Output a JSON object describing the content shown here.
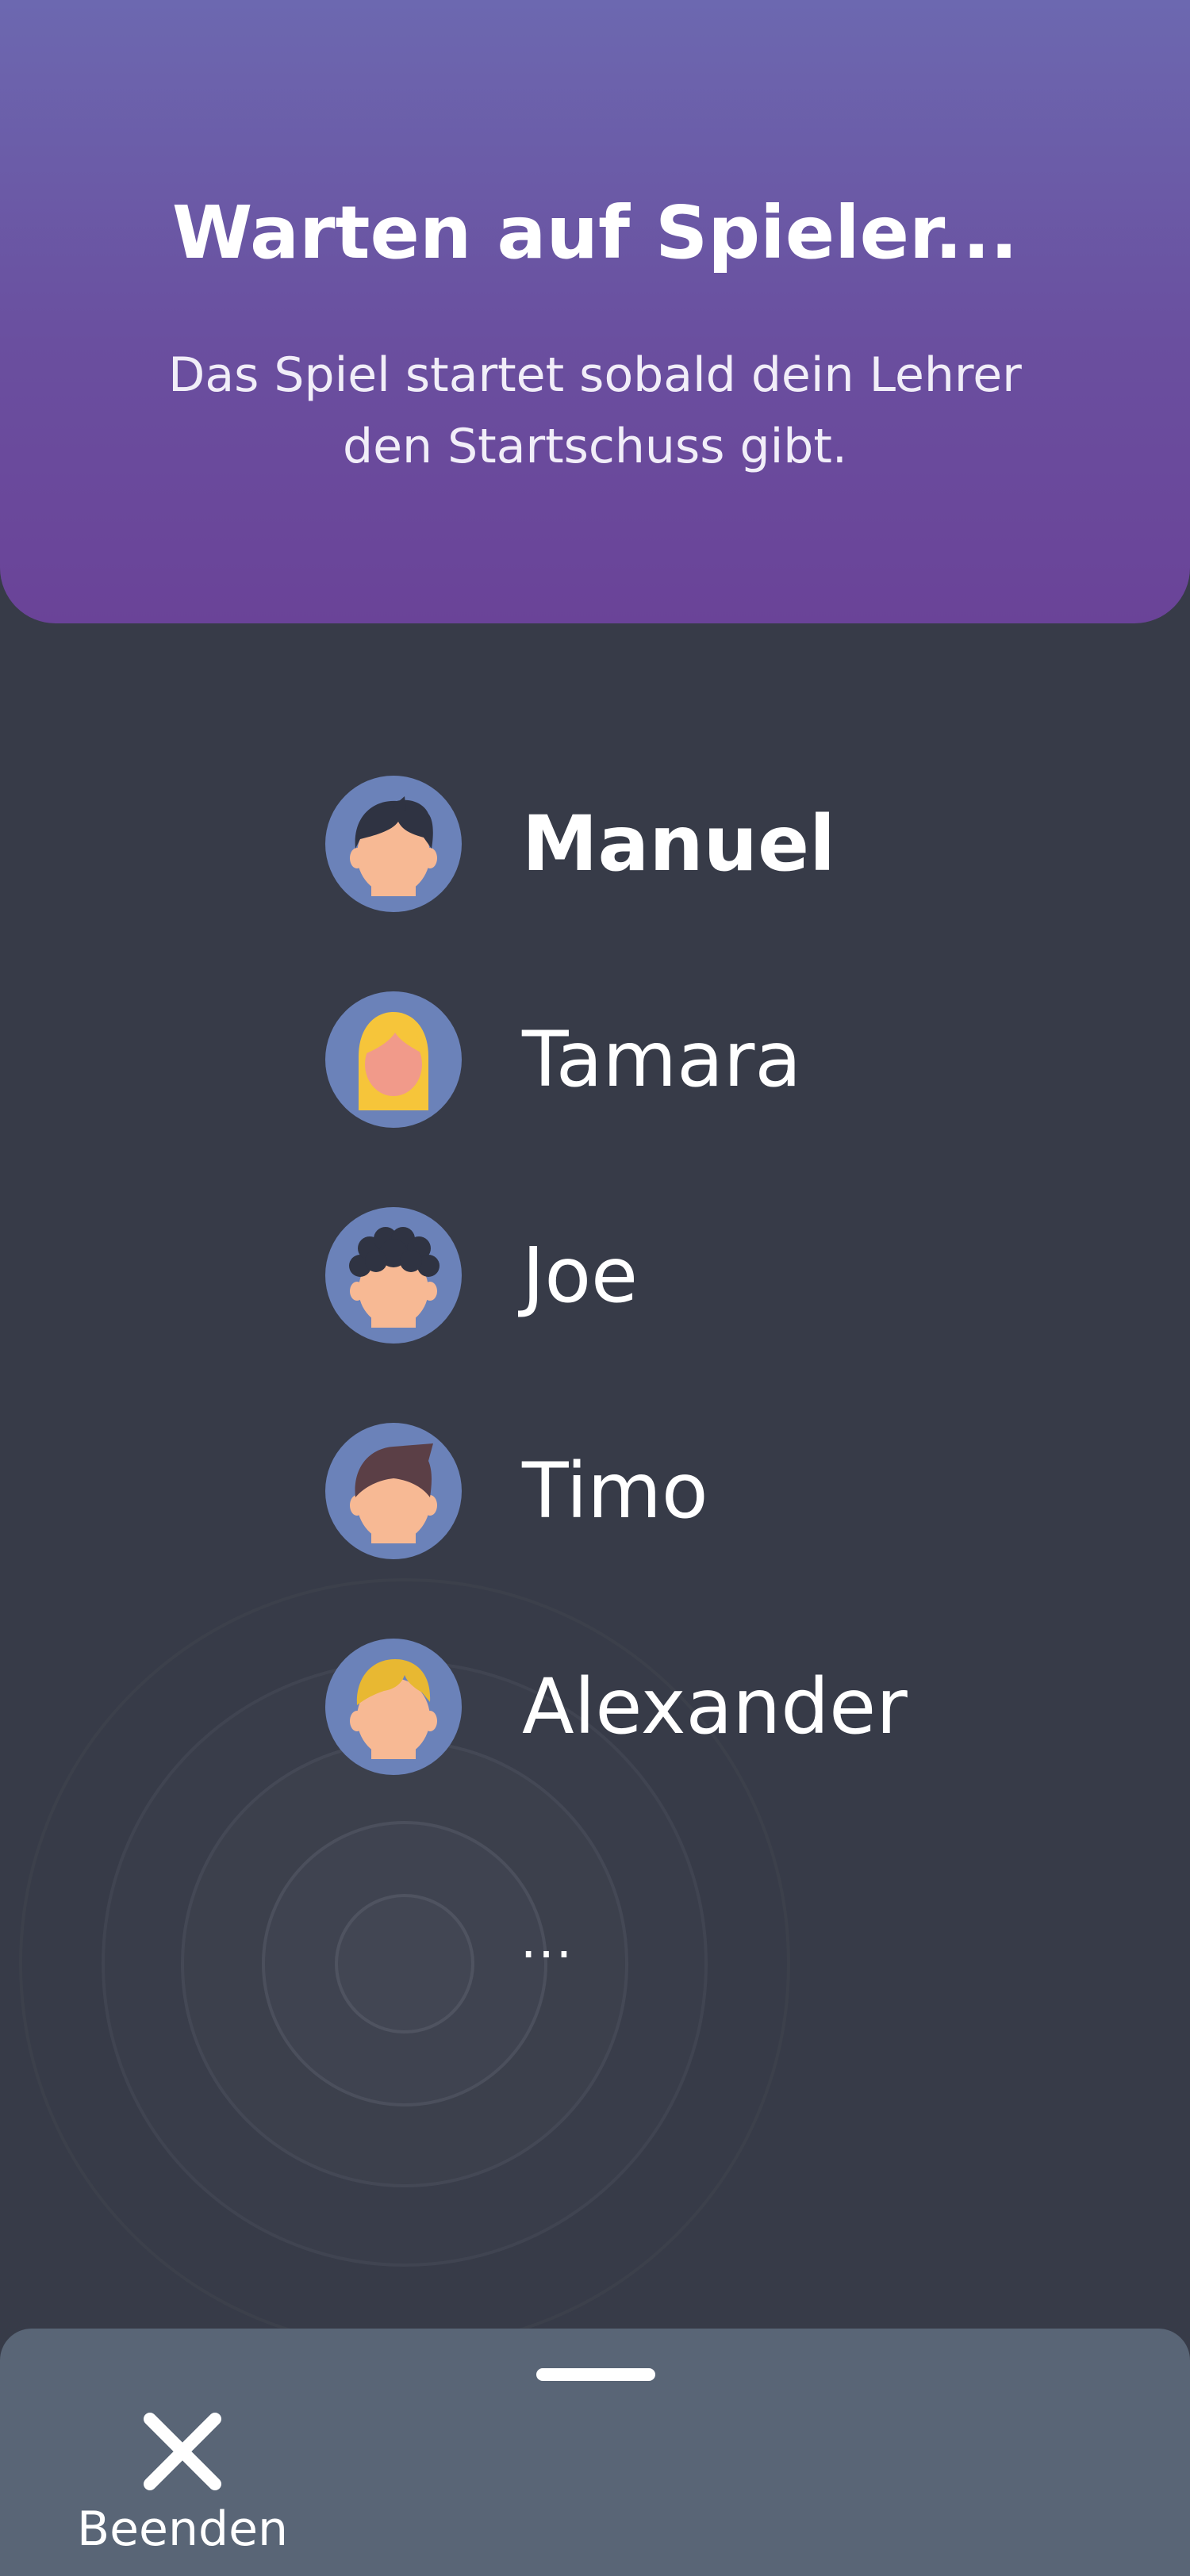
{
  "header": {
    "title": "Warten auf Spieler...",
    "subtitle": "Das Spiel startet sobald dein Lehrer den Startschuss gibt."
  },
  "players": [
    {
      "name": "Manuel",
      "avatar": "avatar-boy-dark-hair-icon",
      "highlight": true
    },
    {
      "name": "Tamara",
      "avatar": "avatar-girl-blonde-hair-icon",
      "highlight": false
    },
    {
      "name": "Joe",
      "avatar": "avatar-boy-curly-hair-icon",
      "highlight": false
    },
    {
      "name": "Timo",
      "avatar": "avatar-boy-brown-hair-icon",
      "highlight": false
    },
    {
      "name": "Alexander",
      "avatar": "avatar-boy-blond-hair-icon",
      "highlight": false
    }
  ],
  "more_indicator": "...",
  "footer": {
    "end_label": "Beenden",
    "end_icon": "close-icon"
  },
  "colors": {
    "background": "#373b48",
    "header_gradient_top": "#6c68b0",
    "header_gradient_bottom": "#6a4398",
    "avatar_bg": "#6b82b9",
    "skin": "#f7b994",
    "bottom_panel": "#596576"
  }
}
